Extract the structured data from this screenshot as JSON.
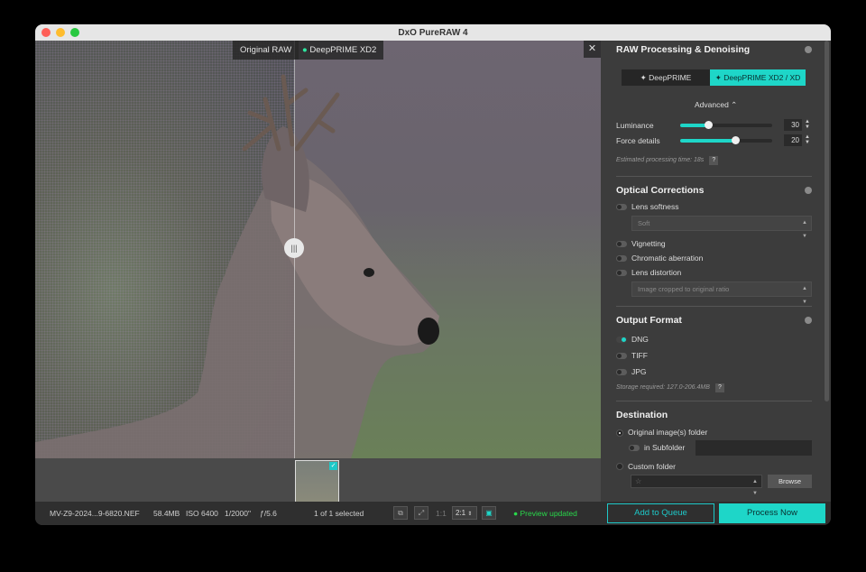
{
  "window": {
    "title": "DxO PureRAW 4"
  },
  "viewer": {
    "label_original": "Original RAW",
    "label_processed": "DeepPRIME XD2",
    "handle_glyph": "|||",
    "close_glyph": "✕"
  },
  "bottombar": {
    "filename": "MV-Z9-2024...9-6820.NEF",
    "filesize": "58.4MB",
    "iso": "ISO 6400",
    "shutter": "1/2000\"",
    "aperture": "ƒ/5.6",
    "selection": "1 of 1 selected",
    "zoom_fit_label": "1:1",
    "zoom_value": "2:1",
    "preview_status": "Preview updated",
    "add_to_queue": "Add to Queue",
    "process_now": "Process Now"
  },
  "panel": {
    "raw": {
      "title": "RAW Processing & Denoising",
      "mode_a": "✦ DeepPRIME",
      "mode_b": "✦ DeepPRIME XD2 / XD",
      "advanced": "Advanced ⌃",
      "luminance_label": "Luminance",
      "luminance_value": "30",
      "luminance_level": 0.3,
      "force_label": "Force details",
      "force_value": "20",
      "force_level": 0.6,
      "estimated": "Estimated processing time:  18s",
      "help": "?"
    },
    "optical": {
      "title": "Optical Corrections",
      "lens_softness": "Lens softness",
      "softness_value": "Soft",
      "vignetting": "Vignetting",
      "chromatic": "Chromatic aberration",
      "distortion": "Lens distortion",
      "distortion_value": "Image cropped to original ratio"
    },
    "output": {
      "title": "Output Format",
      "dng": "DNG",
      "tiff": "TIFF",
      "jpg": "JPG",
      "storage": "Storage required: 127.0-206.4MB",
      "help": "?"
    },
    "destination": {
      "title": "Destination",
      "original_folder": "Original image(s) folder",
      "subfolder": "in Subfolder",
      "custom_folder": "Custom folder",
      "folder_star": "☆",
      "browse": "Browse"
    }
  },
  "colors": {
    "accent": "#1ed6c8",
    "preview_ok": "#29d94b"
  }
}
